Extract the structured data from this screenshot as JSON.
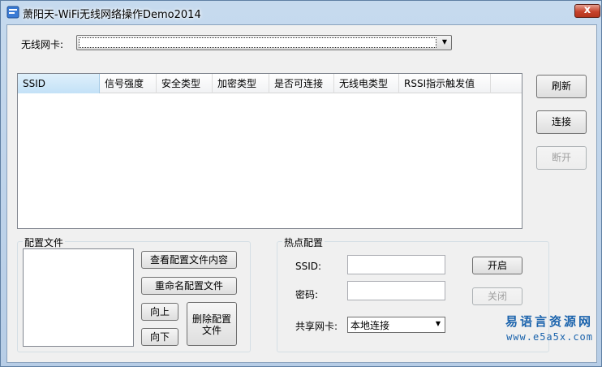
{
  "window": {
    "title": "萧阳天-WiFi无线网络操作Demo2014",
    "close_label": "x"
  },
  "adapter": {
    "label": "无线网卡:",
    "selected": ""
  },
  "network_list": {
    "columns": [
      "SSID",
      "信号强度",
      "安全类型",
      "加密类型",
      "是否可连接",
      "无线电类型",
      "RSSI指示触发值"
    ],
    "rows": []
  },
  "actions": {
    "refresh": "刷新",
    "connect": "连接",
    "disconnect": "断开"
  },
  "profiles": {
    "title": "配置文件",
    "items": [],
    "view_content": "查看配置文件内容",
    "rename": "重命名配置文件",
    "move_up": "向上",
    "move_down": "向下",
    "delete_line1": "删除配置",
    "delete_line2": "文件"
  },
  "hotspot": {
    "title": "热点配置",
    "ssid_label": "SSID:",
    "ssid_value": "",
    "password_label": "密码:",
    "password_value": "",
    "share_label": "共享网卡:",
    "share_selected": "本地连接",
    "start": "开启",
    "stop": "关闭"
  },
  "watermark": {
    "cn": "易语言资源网",
    "en": "www.e5a5x.com"
  },
  "colors": {
    "title_bar": "#c6daee",
    "close_button": "#c7432c",
    "window_bg": "#f0f0f0",
    "header_selected": "#c3e1f7",
    "watermark": "#1c64ad"
  }
}
